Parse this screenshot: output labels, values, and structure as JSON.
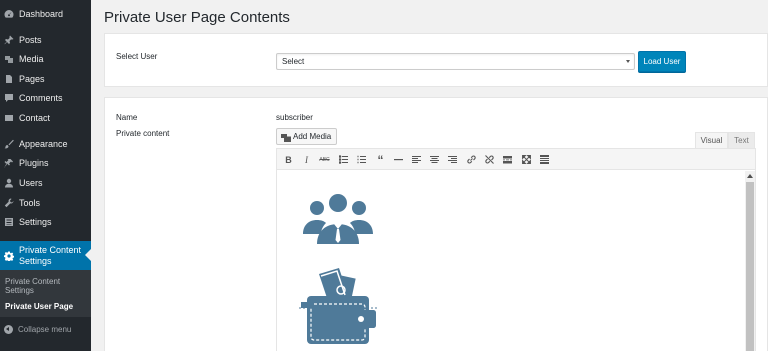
{
  "sidebar": {
    "items": [
      {
        "label": "Dashboard",
        "icon": "dashboard-icon"
      },
      {
        "label": "Posts",
        "icon": "pin-icon"
      },
      {
        "label": "Media",
        "icon": "media-icon"
      },
      {
        "label": "Pages",
        "icon": "pages-icon"
      },
      {
        "label": "Comments",
        "icon": "comment-icon"
      },
      {
        "label": "Contact",
        "icon": "mail-icon"
      },
      {
        "label": "Appearance",
        "icon": "brush-icon"
      },
      {
        "label": "Plugins",
        "icon": "plugin-icon"
      },
      {
        "label": "Users",
        "icon": "user-icon"
      },
      {
        "label": "Tools",
        "icon": "wrench-icon"
      },
      {
        "label": "Settings",
        "icon": "settings-icon"
      }
    ],
    "active": {
      "label_line1": "Private Content",
      "label_line2": "Settings",
      "icon": "gear-icon"
    },
    "submenu": {
      "item1_line1": "Private Content",
      "item1_line2": "Settings",
      "item2": "Private User Page"
    },
    "collapse": "Collapse menu"
  },
  "page": {
    "title": "Private User Page Contents"
  },
  "select_user": {
    "label": "Select User",
    "value": "Select",
    "button": "Load User"
  },
  "user_info": {
    "name_label": "Name",
    "name_value": "subscriber",
    "content_label": "Private content"
  },
  "editor": {
    "add_media": "Add Media",
    "tab_visual": "Visual",
    "tab_text": "Text",
    "toolbar": [
      "bold",
      "italic",
      "strikethrough",
      "bullet-list",
      "numbered-list",
      "blockquote",
      "horizontal-line",
      "align-left",
      "align-center",
      "align-right",
      "link",
      "unlink",
      "read-more",
      "fullscreen",
      "toolbar-toggle"
    ]
  },
  "colors": {
    "sidebar_bg": "#23282d",
    "accent": "#0073aa",
    "button": "#0085ba",
    "icon_blue": "#4f7a99"
  }
}
